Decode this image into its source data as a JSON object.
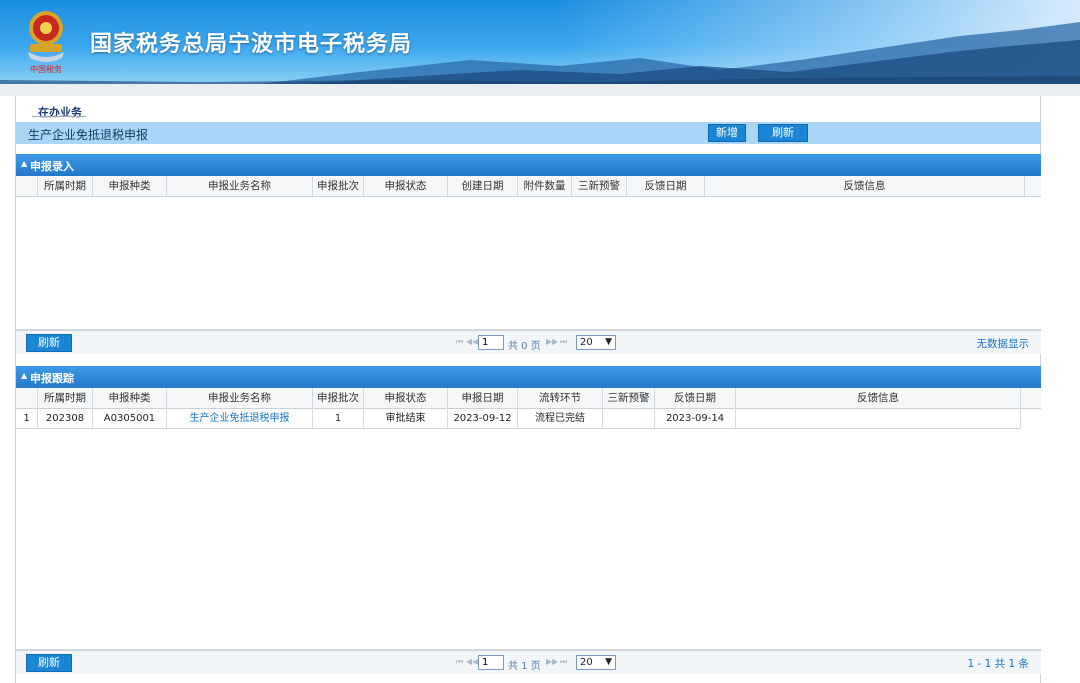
{
  "header": {
    "site_title": "国家税务总局宁波市电子税务局",
    "emblem_icon": "tax-emblem-icon"
  },
  "breadcrumb": "在办业务",
  "titlebar": {
    "title": "生产企业免抵退税申报",
    "new_label": "新增",
    "refresh_label": "刷新"
  },
  "entry_section": {
    "title": "申报录入",
    "columns": [
      "所属时期",
      "申报种类",
      "申报业务名称",
      "申报批次",
      "申报状态",
      "创建日期",
      "附件数量",
      "三新预警",
      "反馈日期",
      "反馈信息"
    ],
    "refresh_label": "刷新",
    "pager": {
      "page_input": "1",
      "page_text": "共 0 页",
      "page_size": "20"
    },
    "summary": "无数据显示"
  },
  "track_section": {
    "title": "申报跟踪",
    "columns": [
      "所属时期",
      "申报种类",
      "申报业务名称",
      "申报批次",
      "申报状态",
      "申报日期",
      "流转环节",
      "三新预警",
      "反馈日期",
      "反馈信息"
    ],
    "rows": [
      {
        "index": "1",
        "period": "202308",
        "kind": "A0305001",
        "name": "生产企业免抵退税申报",
        "batch": "1",
        "status": "审批结束",
        "declare_date": "2023-09-12",
        "flow": "流程已完结",
        "warning": "",
        "feedback_date": "2023-09-14",
        "feedback_info": ""
      }
    ],
    "refresh_label": "刷新",
    "pager": {
      "page_input": "1",
      "page_text": "共 1 页",
      "page_size": "20"
    },
    "summary": "1 - 1  共 1 条"
  },
  "colors": {
    "accent": "#1b86d6",
    "titlebar_bg": "#a9d5f7",
    "section_head": "#2478cc"
  }
}
